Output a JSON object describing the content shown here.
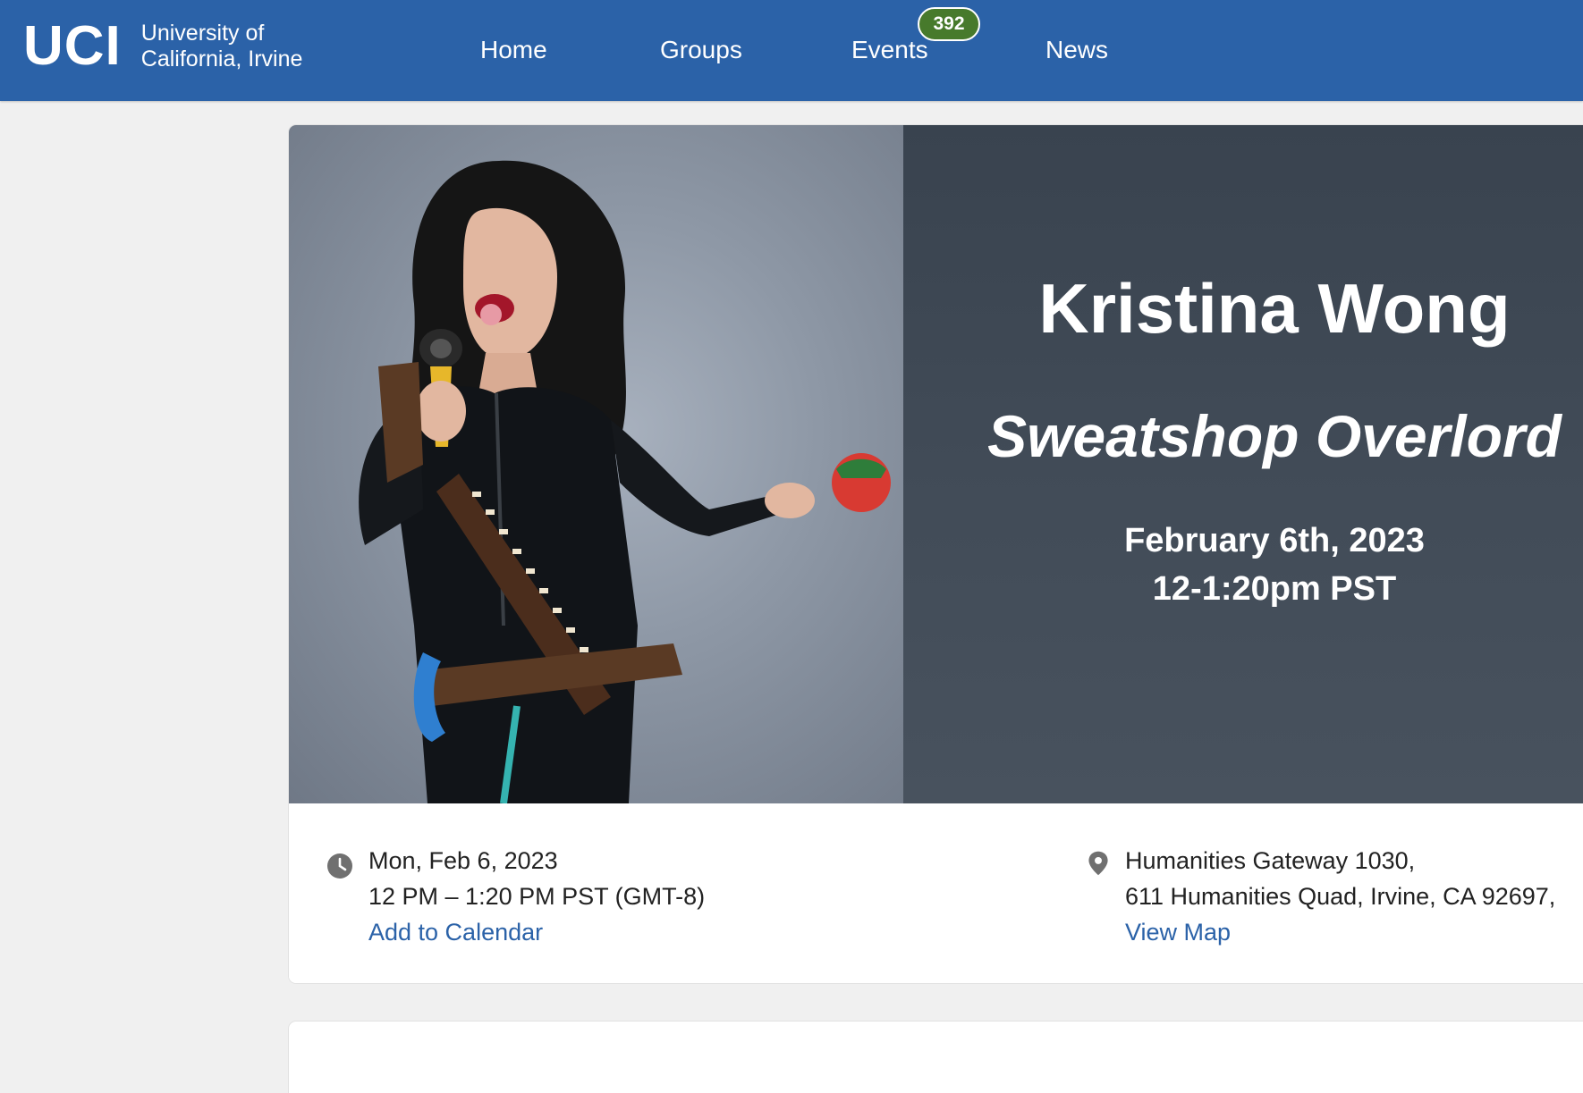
{
  "header": {
    "logo_mark": "UCI",
    "logo_line1": "University of",
    "logo_line2": "California, Irvine",
    "nav": {
      "home": "Home",
      "groups": "Groups",
      "events": "Events",
      "events_badge": "392",
      "news": "News"
    }
  },
  "event": {
    "banner": {
      "name": "Kristina Wong",
      "show": "Sweatshop Overlord",
      "date_line": "February 6th, 2023",
      "time_line": "12-1:20pm PST"
    },
    "datetime": {
      "date": "Mon, Feb 6, 2023",
      "time": "12 PM – 1:20 PM PST (GMT-8)",
      "calendar_link": "Add to Calendar"
    },
    "location": {
      "line1": "Humanities Gateway 1030,",
      "line2": "611 Humanities Quad, Irvine, CA 92697,",
      "map_link": "View Map"
    }
  },
  "icons": {
    "time": "clock-icon",
    "location": "map-pin-icon"
  },
  "colors": {
    "header_bg": "#2b62a8",
    "badge_bg": "#477a2c",
    "link": "#2b62a8",
    "page_bg": "#f0f0f0",
    "banner_panel": "#414b57"
  }
}
